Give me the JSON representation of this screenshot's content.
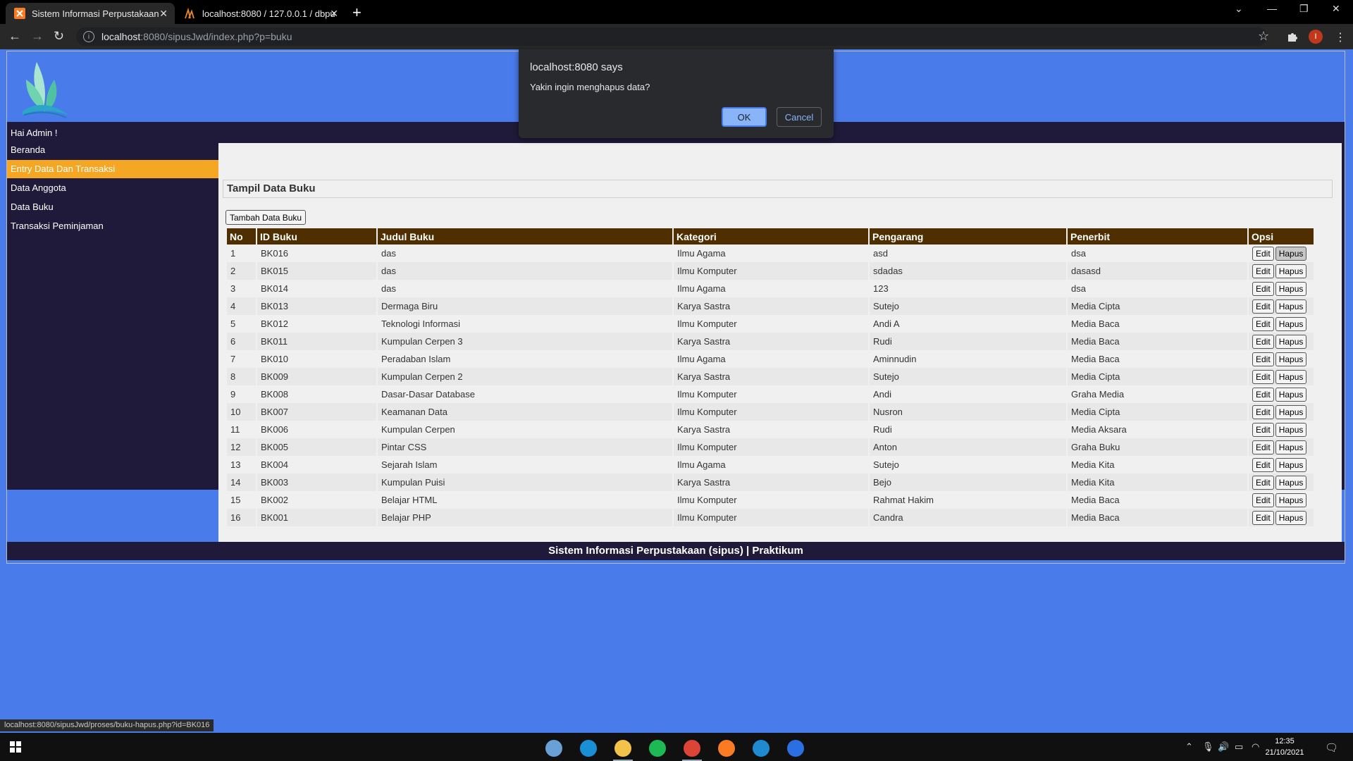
{
  "browser": {
    "tabs": [
      {
        "title": "Sistem Informasi Perpustakaan",
        "active": true,
        "icon": "xampp-icon"
      },
      {
        "title": "localhost:8080 / 127.0.0.1 / dbpu",
        "active": false,
        "icon": "phpmyadmin-icon"
      }
    ],
    "url_host": "localhost",
    "url_path": ":8080/sipusJwd/index.php?p=buku",
    "profile_initial": "I"
  },
  "dialog": {
    "title": "localhost:8080 says",
    "message": "Yakin ingin menghapus data?",
    "ok_label": "OK",
    "cancel_label": "Cancel"
  },
  "sidebar": {
    "greeting": "Hai Admin !",
    "items": [
      {
        "label": "Beranda",
        "active": false
      },
      {
        "label": "Entry Data Dan Transaksi",
        "active": true
      },
      {
        "label": "Data Anggota",
        "active": false
      },
      {
        "label": "Data Buku",
        "active": false
      },
      {
        "label": "Transaksi Peminjaman",
        "active": false
      }
    ]
  },
  "main": {
    "panel_title": "Tampil Data Buku",
    "add_button": "Tambah Data Buku",
    "edit_label": "Edit",
    "delete_label": "Hapus",
    "columns": [
      "No",
      "ID Buku",
      "Judul Buku",
      "Kategori",
      "Pengarang",
      "Penerbit",
      "Opsi"
    ],
    "rows": [
      [
        "1",
        "BK016",
        "das",
        "Ilmu Agama",
        "asd",
        "dsa"
      ],
      [
        "2",
        "BK015",
        "das",
        "Ilmu Komputer",
        "sdadas",
        "dasasd"
      ],
      [
        "3",
        "BK014",
        "das",
        "Ilmu Agama",
        "123",
        "dsa"
      ],
      [
        "4",
        "BK013",
        "Dermaga Biru",
        "Karya Sastra",
        "Sutejo",
        "Media Cipta"
      ],
      [
        "5",
        "BK012",
        "Teknologi Informasi",
        "Ilmu Komputer",
        "Andi A",
        "Media Baca"
      ],
      [
        "6",
        "BK011",
        "Kumpulan Cerpen 3",
        "Karya Sastra",
        "Rudi",
        "Media Baca"
      ],
      [
        "7",
        "BK010",
        "Peradaban Islam",
        "Ilmu Agama",
        "Aminnudin",
        "Media Baca"
      ],
      [
        "8",
        "BK009",
        "Kumpulan Cerpen 2",
        "Karya Sastra",
        "Sutejo",
        "Media Cipta"
      ],
      [
        "9",
        "BK008",
        "Dasar-Dasar Database",
        "Ilmu Komputer",
        "Andi",
        "Graha Media"
      ],
      [
        "10",
        "BK007",
        "Keamanan Data",
        "Ilmu Komputer",
        "Nusron",
        "Media Cipta"
      ],
      [
        "11",
        "BK006",
        "Kumpulan Cerpen",
        "Karya Sastra",
        "Rudi",
        "Media Aksara"
      ],
      [
        "12",
        "BK005",
        "Pintar CSS",
        "Ilmu Komputer",
        "Anton",
        "Graha Buku"
      ],
      [
        "13",
        "BK004",
        "Sejarah Islam",
        "Ilmu Agama",
        "Sutejo",
        "Media Kita"
      ],
      [
        "14",
        "BK003",
        "Kumpulan Puisi",
        "Karya Sastra",
        "Bejo",
        "Media Kita"
      ],
      [
        "15",
        "BK002",
        "Belajar HTML",
        "Ilmu Komputer",
        "Rahmat Hakim",
        "Media Baca"
      ],
      [
        "16",
        "BK001",
        "Belajar PHP",
        "Ilmu Komputer",
        "Candra",
        "Media Baca"
      ]
    ],
    "footer": "Sistem Informasi Perpustakaan (sipus) | Praktikum"
  },
  "status_url": "localhost:8080/sipusJwd/proses/buku-hapus.php?id=BK016",
  "taskbar": {
    "apps": [
      {
        "name": "notepad-icon",
        "color": "#6aa0d8"
      },
      {
        "name": "edge-icon",
        "color": "#1a8fd6"
      },
      {
        "name": "file-explorer-icon",
        "color": "#f2c24b"
      },
      {
        "name": "spotify-icon",
        "color": "#1db954"
      },
      {
        "name": "chrome-icon",
        "color": "#db4437"
      },
      {
        "name": "xampp-icon",
        "color": "#fb7a24"
      },
      {
        "name": "vscode-icon",
        "color": "#1f8ad2"
      },
      {
        "name": "maps-icon",
        "color": "#2b6fe3"
      }
    ],
    "time": "12:35",
    "date": "21/10/2021"
  },
  "colors": {
    "page_bg": "#4a7bea",
    "dark_band": "#1f1a3a",
    "menu_active": "#f5a623",
    "table_header": "#4f2f00"
  }
}
